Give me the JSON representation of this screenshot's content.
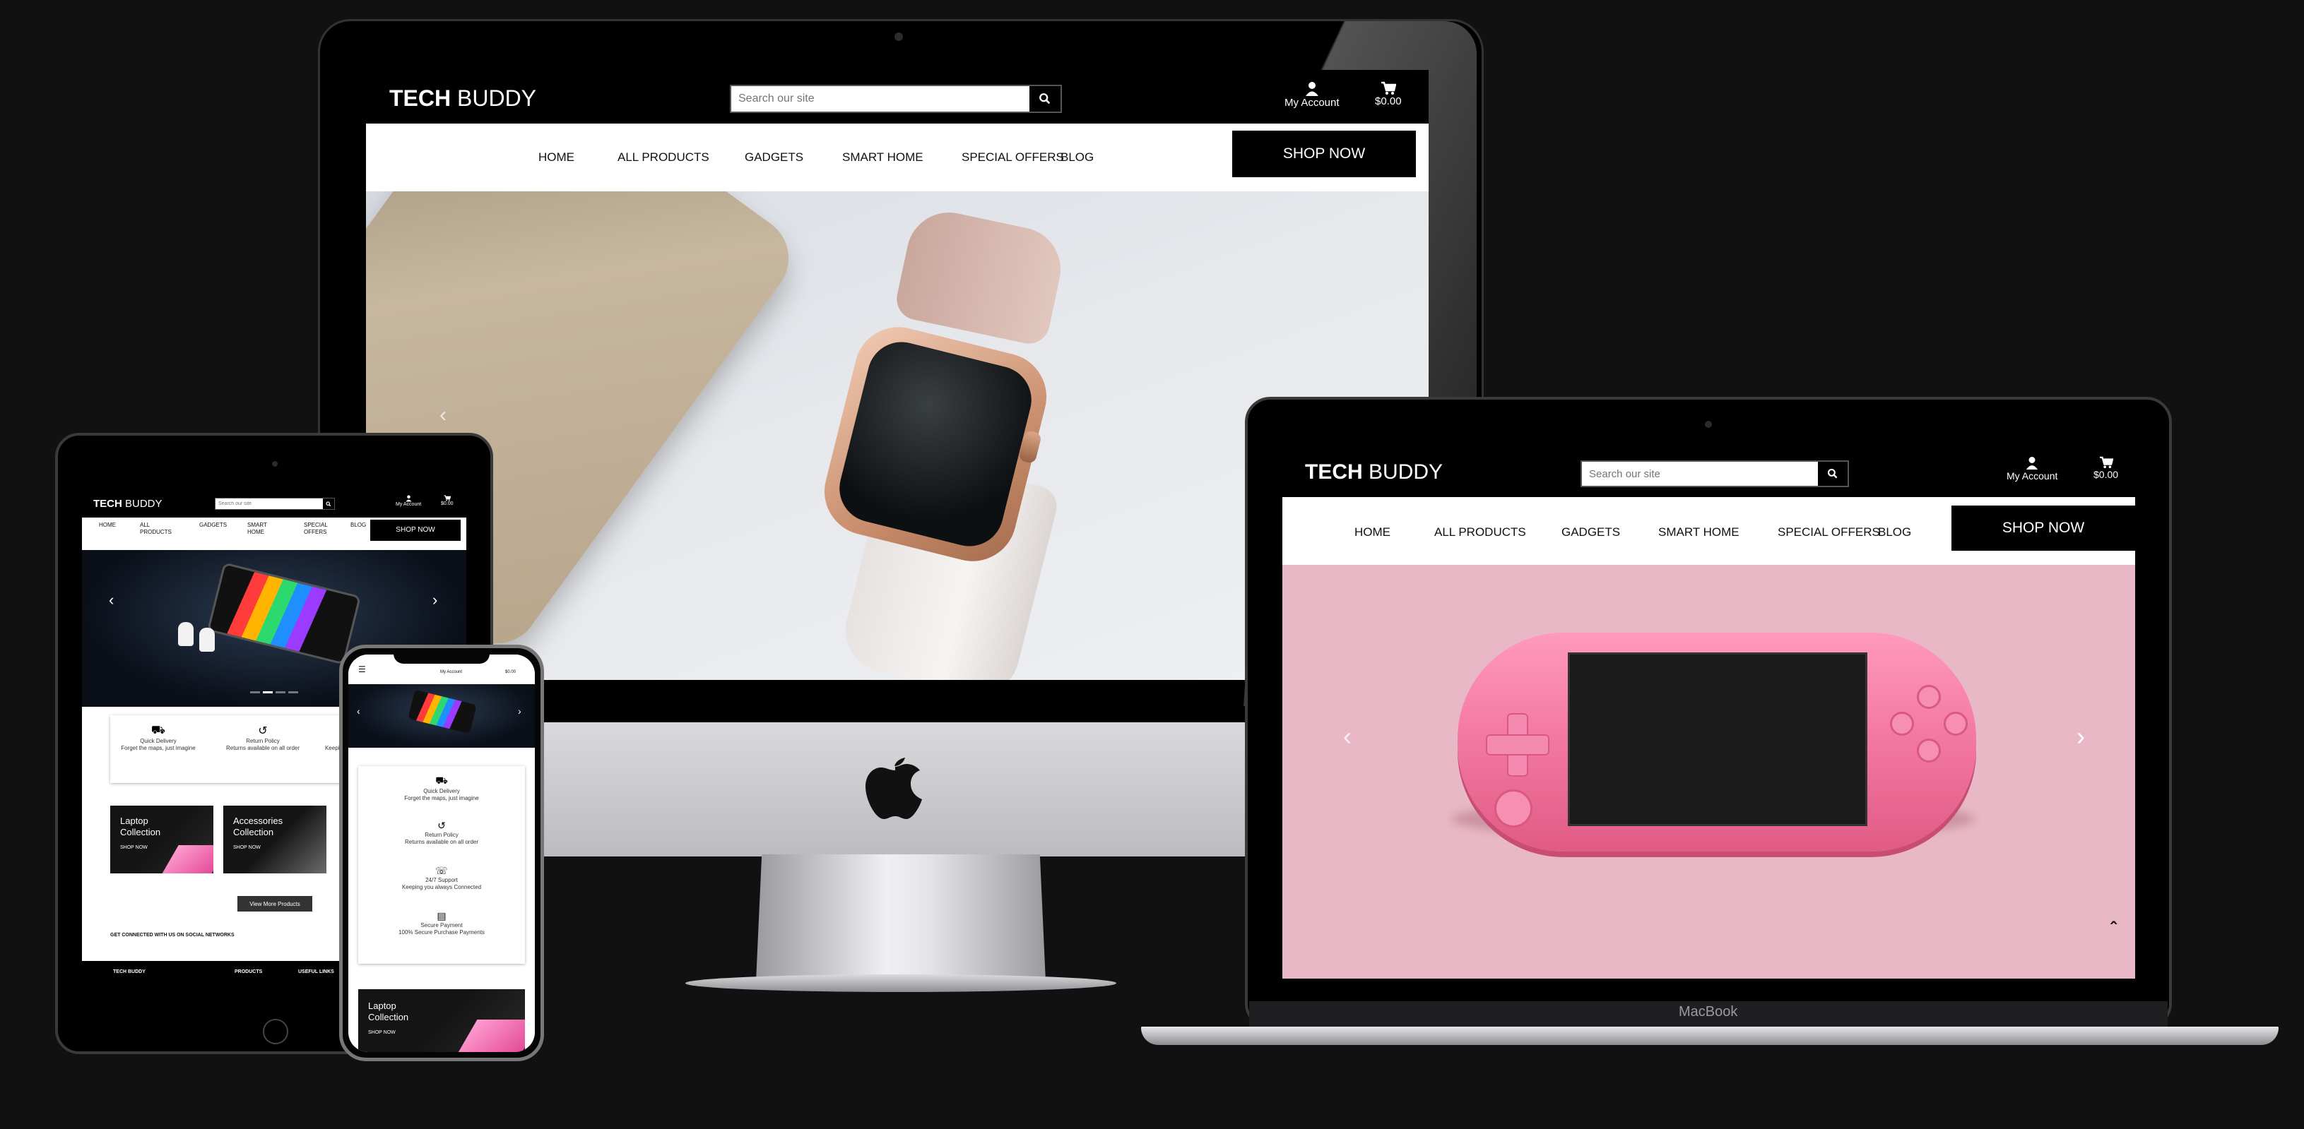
{
  "brand": {
    "bold": "TECH",
    "light": "BUDDY",
    "full": "TECH BUDDY"
  },
  "search": {
    "placeholder": "Search our site"
  },
  "account": {
    "label": "My Account"
  },
  "cart": {
    "total": "$0.00"
  },
  "nav": {
    "home": "HOME",
    "all_products": "ALL PRODUCTS",
    "gadgets": "GADGETS",
    "smart_home": "SMART HOME",
    "special_offers": "SPECIAL OFFERS",
    "blog": "BLOG",
    "all_products_wrapped": [
      "ALL",
      "PRODUCTS"
    ],
    "smart_home_wrapped": [
      "SMART",
      "HOME"
    ],
    "special_offers_wrapped": [
      "SPECIAL",
      "OFFERS"
    ]
  },
  "cta": {
    "shop_now": "SHOP NOW"
  },
  "laptop": {
    "brand_label": "MacBook"
  },
  "features": {
    "delivery": {
      "title": "Quick Delivery",
      "text": "Forget the maps, just imagine"
    },
    "returns": {
      "title": "Return Policy",
      "text": "Returns available on all order"
    },
    "support": {
      "title": "24/7 Support",
      "text": "Keeping you always Connected"
    },
    "payment": {
      "title": "Secure Payment",
      "text": "100% Secure Purchase Payments"
    }
  },
  "collections": {
    "laptop": {
      "title": "Laptop Collection",
      "cta": "SHOP NOW"
    },
    "accessories": {
      "title": "Accessories Collection",
      "cta": "SHOP NOW"
    }
  },
  "view_more": "View More Products",
  "social_heading": "GET CONNECTED WITH US ON SOCIAL NETWORKS",
  "footer": {
    "col1": "TECH BUDDY",
    "col2": "PRODUCTS",
    "col3": "USEFUL LINKS"
  },
  "colors": {
    "header_bg": "#000000",
    "laptop_hero": "#e8b8c6",
    "psp_pink": "#f47aa3",
    "page_bg": "#111111"
  }
}
